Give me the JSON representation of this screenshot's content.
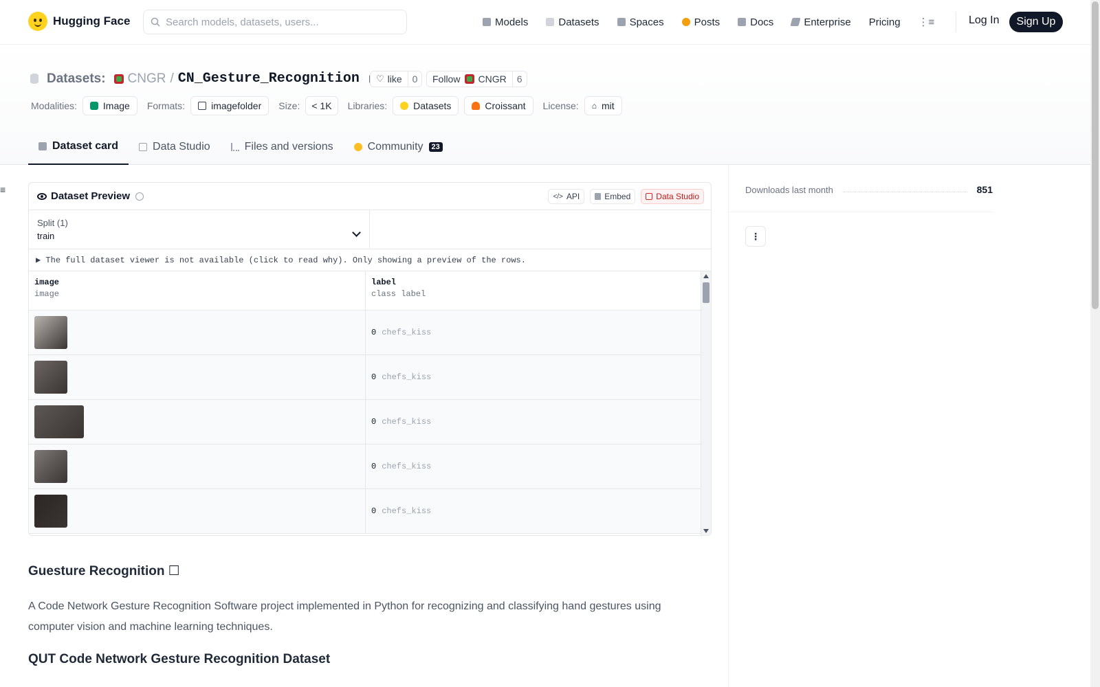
{
  "header": {
    "brand": "Hugging Face",
    "search_placeholder": "Search models, datasets, users...",
    "nav": [
      {
        "label": "Models",
        "color": "#9ca3af"
      },
      {
        "label": "Datasets",
        "color": "#d1d5db"
      },
      {
        "label": "Spaces",
        "color": "#9ca3af"
      },
      {
        "label": "Posts",
        "color": "#f59e0b"
      },
      {
        "label": "Docs",
        "color": "#9ca3af"
      },
      {
        "label": "Enterprise",
        "color": "#9ca3af"
      },
      {
        "label": "Pricing",
        "color": ""
      }
    ],
    "login": "Log In",
    "signup": "Sign Up"
  },
  "repo": {
    "section": "Datasets:",
    "org": "CNGR",
    "name": "CN_Gesture_Recognition",
    "like_label": "like",
    "like_count": "0",
    "follow_label": "Follow",
    "follow_org": "CNGR",
    "follow_count": "6",
    "meta": {
      "modalities_label": "Modalities:",
      "modalities": "Image",
      "formats_label": "Formats:",
      "formats": "imagefolder",
      "size_label": "Size:",
      "size": "< 1K",
      "libraries_label": "Libraries:",
      "lib1": "Datasets",
      "lib2": "Croissant",
      "license_label": "License:",
      "license": "mit"
    },
    "tabs": {
      "card": "Dataset card",
      "studio": "Data Studio",
      "files": "Files and versions",
      "community": "Community",
      "community_count": "23"
    }
  },
  "preview": {
    "title": "Dataset Preview",
    "api": "API",
    "embed": "Embed",
    "studio": "Data Studio",
    "split_label": "Split (1)",
    "split_value": "train",
    "notice": "▶ The full dataset viewer is not available (click to read why). Only showing a preview of the rows.",
    "columns": [
      {
        "name": "image",
        "type": "image"
      },
      {
        "name": "label",
        "type": "class label"
      }
    ],
    "rows": [
      {
        "label_id": "0",
        "label_name": "chefs_kiss",
        "thumb_w": 48,
        "thumb_color": "#b8b2ae"
      },
      {
        "label_id": "0",
        "label_name": "chefs_kiss",
        "thumb_w": 48,
        "thumb_color": "#6b6462"
      },
      {
        "label_id": "0",
        "label_name": "chefs_kiss",
        "thumb_w": 72,
        "thumb_color": "#5c5855"
      },
      {
        "label_id": "0",
        "label_name": "chefs_kiss",
        "thumb_w": 48,
        "thumb_color": "#7d7976"
      },
      {
        "label_id": "0",
        "label_name": "chefs_kiss",
        "thumb_w": 48,
        "thumb_color": "#2b2523"
      }
    ]
  },
  "card": {
    "h1": "Guesture Recognition ☐",
    "p1": "A Code Network Gesture Recognition Software project implemented in Python for recognizing and classifying hand gestures using computer vision and machine learning techniques.",
    "h2": "QUT Code Network Gesture Recognition Dataset"
  },
  "sidebar": {
    "downloads_label": "Downloads last month",
    "downloads_value": "851"
  }
}
